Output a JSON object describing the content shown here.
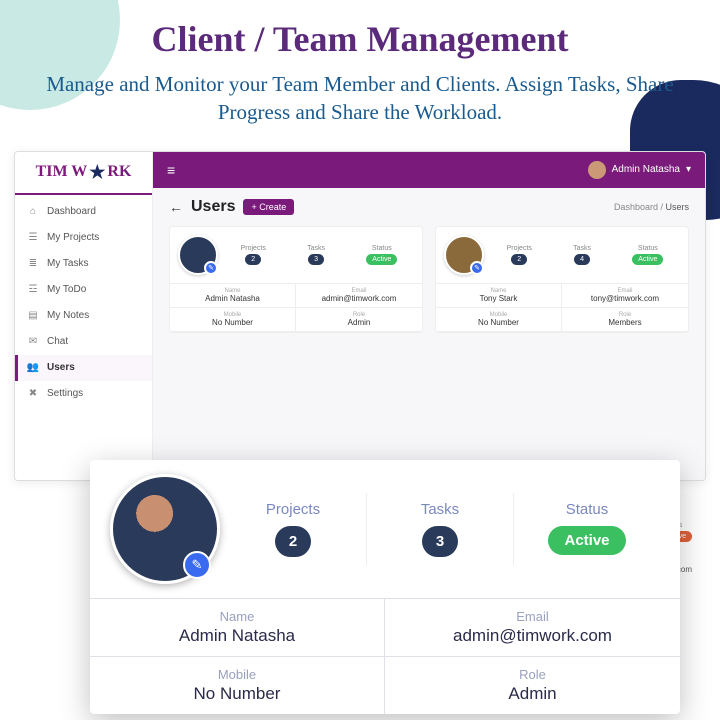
{
  "hero": {
    "title": "Client / Team Management",
    "subtitle": "Manage and Monitor your Team Member and Clients. Assign Tasks, Share Progress and Share the Workload."
  },
  "brand": {
    "part1": "TIM W",
    "part2": "RK"
  },
  "nav": {
    "items": [
      "Dashboard",
      "My Projects",
      "My Tasks",
      "My ToDo",
      "My Notes",
      "Chat",
      "Users",
      "Settings"
    ]
  },
  "topbar": {
    "user": "Admin Natasha"
  },
  "page": {
    "title": "Users",
    "create": "+ Create",
    "crumb1": "Dashboard",
    "crumb2": "Users"
  },
  "labels": {
    "projects": "Projects",
    "tasks": "Tasks",
    "status": "Status",
    "name": "Name",
    "email": "Email",
    "mobile": "Mobile",
    "role": "Role",
    "active": "Active",
    "deactive": "Deactive",
    "nonumber": "No Number",
    "admin": "Admin",
    "members": "Members"
  },
  "cards": [
    {
      "projects": "2",
      "tasks": "3",
      "status": "Active",
      "name": "Admin Natasha",
      "email": "admin@timwork.com",
      "mobile": "No Number",
      "role": "Admin"
    },
    {
      "projects": "2",
      "tasks": "4",
      "status": "Active",
      "name": "Tony Stark",
      "email": "tony@timwork.com",
      "mobile": "No Number",
      "role": "Members"
    }
  ],
  "extra": {
    "email_frag": "il.com"
  },
  "detail": {
    "projects": "2",
    "tasks": "3",
    "status": "Active",
    "name": "Admin Natasha",
    "email": "admin@timwork.com",
    "mobile": "No Number",
    "role": "Admin"
  }
}
